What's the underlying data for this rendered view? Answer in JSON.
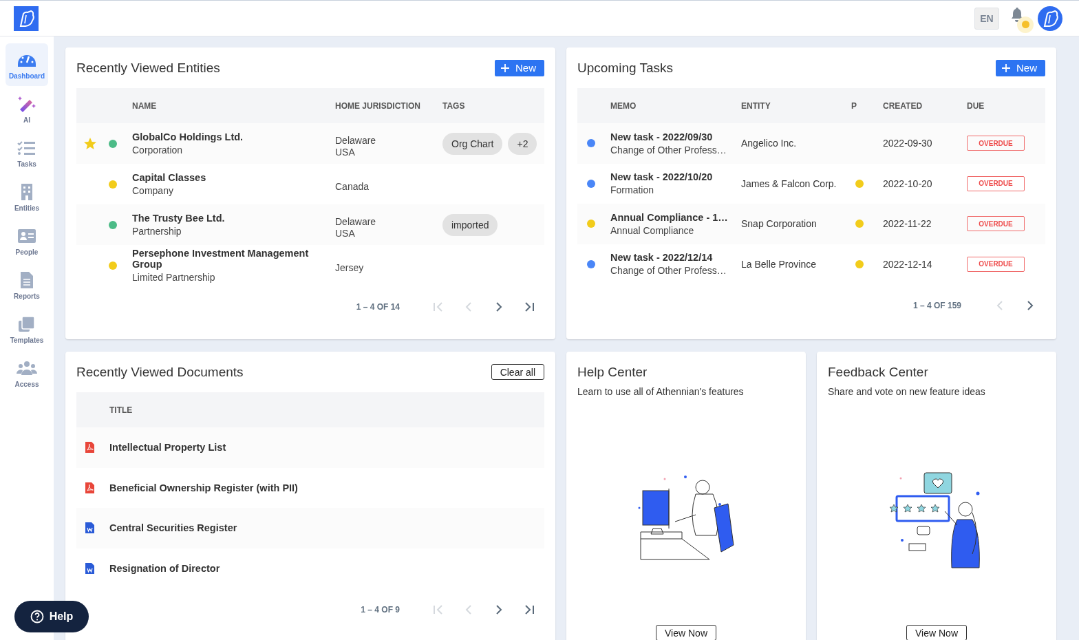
{
  "header": {
    "language": "EN",
    "notifications_unread": true
  },
  "sidebar": {
    "items": [
      {
        "label": "Dashboard",
        "selected": true
      },
      {
        "label": "AI",
        "selected": false
      },
      {
        "label": "Tasks",
        "selected": false
      },
      {
        "label": "Entities",
        "selected": false
      },
      {
        "label": "People",
        "selected": false
      },
      {
        "label": "Reports",
        "selected": false
      },
      {
        "label": "Templates",
        "selected": false
      },
      {
        "label": "Access",
        "selected": false
      }
    ]
  },
  "entities": {
    "title": "Recently Viewed Entities",
    "new_button": "New",
    "columns": [
      "NAME",
      "HOME JURISDICTION",
      "TAGS"
    ],
    "rows": [
      {
        "favorite": true,
        "color": "#4cbb87",
        "name": "GlobalCo Holdings Ltd.",
        "type": "Corporation",
        "jurisdiction": [
          "Delaware",
          "USA"
        ],
        "tags": [
          "Org Chart",
          "+2"
        ]
      },
      {
        "favorite": false,
        "color": "#f2cc1b",
        "name": "Capital Classes",
        "type": "Company",
        "jurisdiction": [
          "Canada"
        ],
        "tags": []
      },
      {
        "favorite": false,
        "color": "#4cbb87",
        "name": "The Trusty Bee Ltd.",
        "type": "Partnership",
        "jurisdiction": [
          "Delaware",
          "USA"
        ],
        "tags": [
          "imported"
        ]
      },
      {
        "favorite": false,
        "color": "#f2cc1b",
        "name": "Persephone Investment Management Group",
        "type": "Limited Partnership",
        "jurisdiction": [
          "Jersey"
        ],
        "tags": []
      }
    ],
    "pager": {
      "range": "1 – 4 OF 14",
      "buttons": [
        {
          "kind": "first",
          "disabled": true
        },
        {
          "kind": "prev",
          "disabled": true
        },
        {
          "kind": "next",
          "disabled": false
        },
        {
          "kind": "last",
          "disabled": false
        }
      ]
    }
  },
  "tasks": {
    "title": "Upcoming Tasks",
    "new_button": "New",
    "columns": [
      "MEMO",
      "ENTITY",
      "P",
      "CREATED",
      "DUE"
    ],
    "rows": [
      {
        "color": "#4a86f7",
        "title": "New task - 2022/09/30",
        "subtitle": "Change of Other Profess…",
        "entity": "Angelico Inc.",
        "flagged": false,
        "created": "2022-09-30",
        "due": "OVERDUE"
      },
      {
        "color": "#4a86f7",
        "title": "New task - 2022/10/20",
        "subtitle": "Formation",
        "entity": "James & Falcon Corp.",
        "flagged": true,
        "created": "2022-10-20",
        "due": "OVERDUE"
      },
      {
        "color": "#f2cc1b",
        "title": "Annual Compliance - 1…",
        "subtitle": "Annual Compliance",
        "entity": "Snap Corporation",
        "flagged": true,
        "created": "2022-11-22",
        "due": "OVERDUE"
      },
      {
        "color": "#4a86f7",
        "title": "New task - 2022/12/14",
        "subtitle": "Change of Other Profess…",
        "entity": "La Belle Province",
        "flagged": true,
        "created": "2022-12-14",
        "due": "OVERDUE"
      }
    ],
    "pager": {
      "range": "1 – 4 OF 159",
      "buttons": [
        {
          "kind": "prev",
          "disabled": true
        },
        {
          "kind": "next",
          "disabled": false
        }
      ]
    }
  },
  "documents": {
    "title": "Recently Viewed Documents",
    "clear_button": "Clear all",
    "columns": [
      "TITLE"
    ],
    "rows": [
      {
        "kind": "pdf",
        "title": "Intellectual Property List"
      },
      {
        "kind": "pdf",
        "title": "Beneficial Ownership Register (with PII)"
      },
      {
        "kind": "word",
        "title": "Central Securities Register"
      },
      {
        "kind": "word",
        "title": "Resignation of Director"
      }
    ],
    "pager": {
      "range": "1 – 4 OF 9",
      "buttons": [
        {
          "kind": "first",
          "disabled": true
        },
        {
          "kind": "prev",
          "disabled": true
        },
        {
          "kind": "next",
          "disabled": false
        },
        {
          "kind": "last",
          "disabled": false
        }
      ]
    }
  },
  "promos": [
    {
      "kind": "help",
      "title": "Help Center",
      "text": "Learn to use all of Athennian's features",
      "button": "View Now"
    },
    {
      "kind": "feedback",
      "title": "Feedback Center",
      "text": "Share and vote on new feature ideas",
      "button": "View Now"
    }
  ],
  "help_button": {
    "label": "Help"
  }
}
